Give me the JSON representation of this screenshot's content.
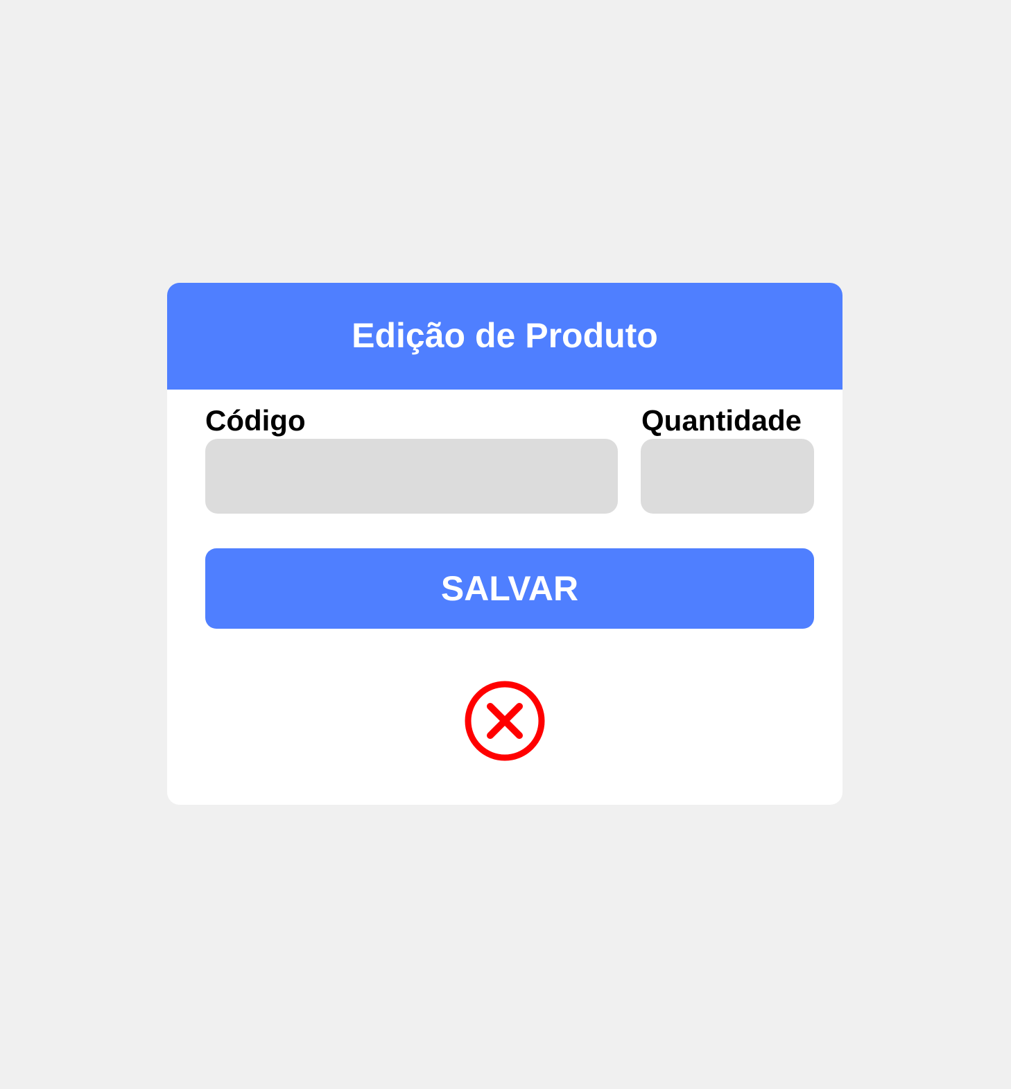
{
  "dialog": {
    "title": "Edição de Produto",
    "fields": {
      "codigo": {
        "label": "Código",
        "value": "",
        "placeholder": ""
      },
      "quantidade": {
        "label": "Quantidade",
        "value": "",
        "placeholder": ""
      }
    },
    "save_label": "SALVAR",
    "close_icon": "close-circle-icon"
  },
  "colors": {
    "background": "#f0f0f0",
    "accent": "#4f7fff",
    "input_fill": "#dcdcdc",
    "close": "#ff0000"
  }
}
